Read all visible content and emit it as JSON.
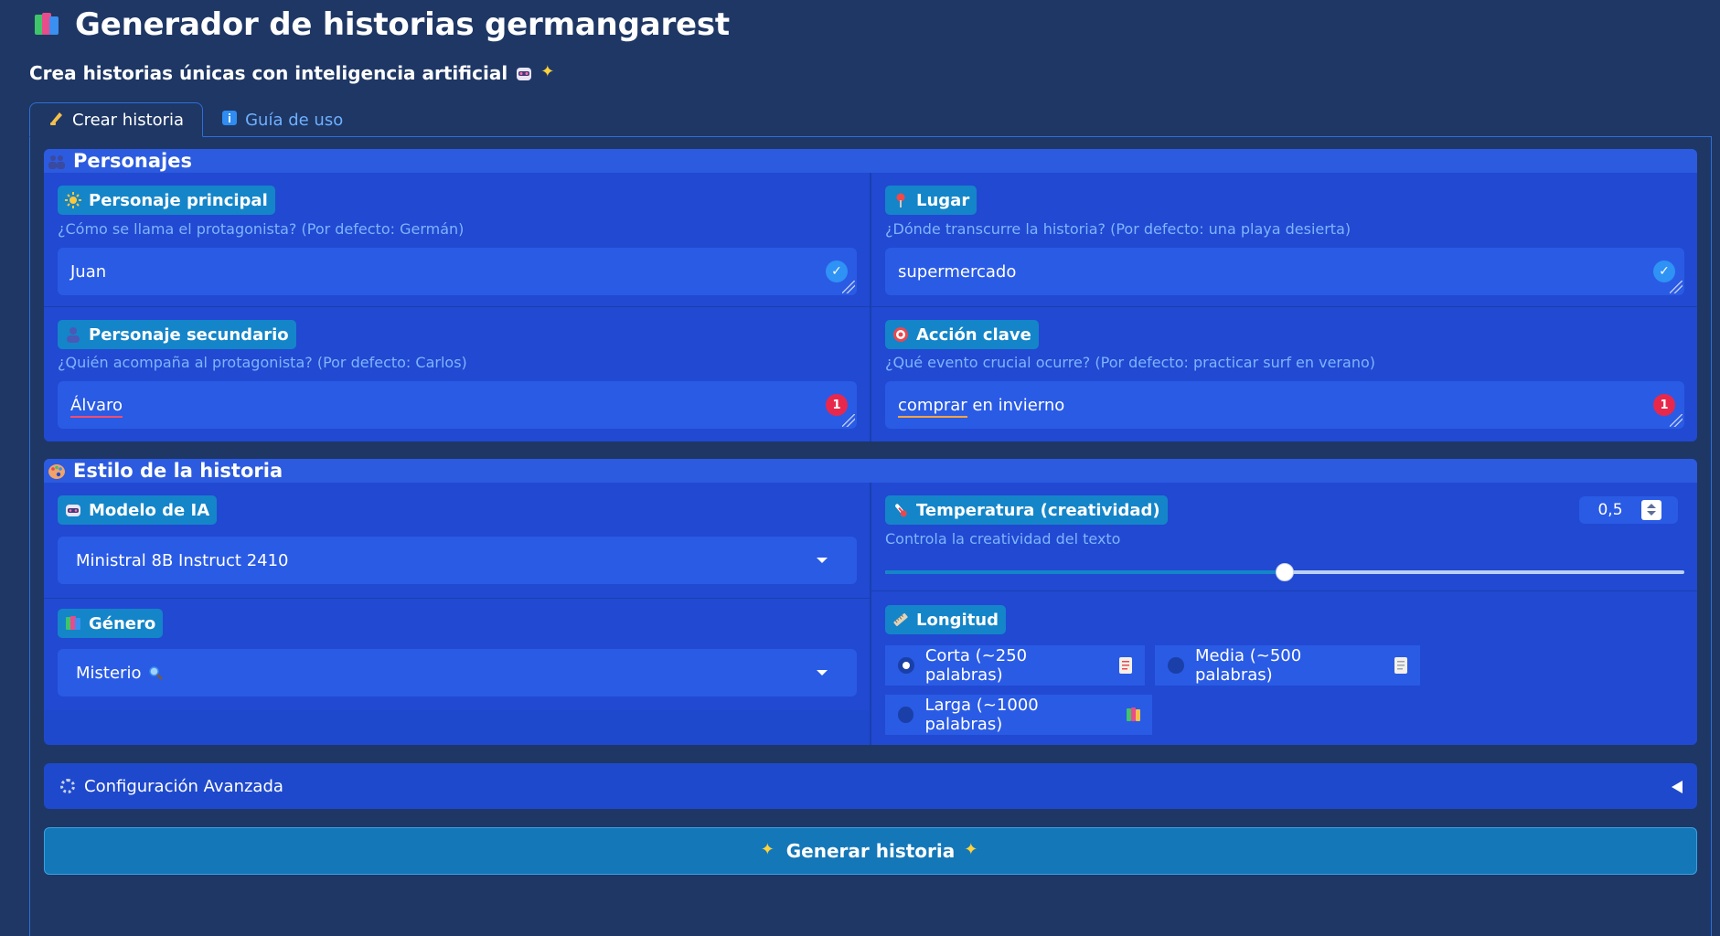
{
  "header": {
    "title": "Generador de historias germangarest",
    "subtitle": "Crea historias únicas con inteligencia artificial"
  },
  "tabs": [
    {
      "label": "Crear historia",
      "active": true
    },
    {
      "label": "Guía de uso",
      "active": false
    }
  ],
  "personajes": {
    "title": "Personajes",
    "principal": {
      "label": "Personaje principal",
      "hint": "¿Cómo se llama el protagonista? (Por defecto: Germán)",
      "value": "Juan",
      "status": "ok"
    },
    "lugar": {
      "label": "Lugar",
      "hint": "¿Dónde transcurre la historia? (Por defecto: una playa desierta)",
      "value": "supermercado",
      "status": "ok"
    },
    "secundario": {
      "label": "Personaje secundario",
      "hint": "¿Quién acompaña al protagonista? (Por defecto: Carlos)",
      "value": "Álvaro",
      "errors": "1"
    },
    "accion": {
      "label": "Acción clave",
      "hint": "¿Qué evento crucial ocurre? (Por defecto: practicar surf en verano)",
      "value_word1": "comprar",
      "value_rest": " en invierno",
      "errors": "1"
    }
  },
  "estilo": {
    "title": "Estilo de la historia",
    "modelo": {
      "label": "Modelo de IA",
      "selected": "Ministral 8B Instruct 2410"
    },
    "genero": {
      "label": "Género",
      "selected": "Misterio"
    },
    "temperatura": {
      "label": "Temperatura (creatividad)",
      "hint": "Controla la creatividad del texto",
      "value": "0,5",
      "fraction": 0.5
    },
    "longitud": {
      "label": "Longitud",
      "options": [
        {
          "label": "Corta (~250 palabras)",
          "checked": true
        },
        {
          "label": "Media (~500 palabras)",
          "checked": false
        },
        {
          "label": "Larga (~1000 palabras)",
          "checked": false
        }
      ]
    }
  },
  "advanced": {
    "label": "Configuración Avanzada"
  },
  "generate": {
    "label": "Generar historia"
  },
  "icons": {
    "title": "books-icon",
    "subtitle": [
      "robot-icon",
      "sparkles-icon"
    ],
    "tab_crear": "writing-hand-icon",
    "tab_guia": "info-icon",
    "personajes": "people-icon",
    "principal": "sun-icon",
    "lugar": "pin-icon",
    "secundario": "person-icon",
    "accion": "target-icon",
    "estilo": "palette-icon",
    "modelo": "robot-icon",
    "genero": "books-icon",
    "misterio": "magnifier-icon",
    "temperatura": "thermometer-icon",
    "longitud": "ruler-icon",
    "advanced": "gear-icon",
    "generate": "sparkles-icon"
  },
  "colors": {
    "background": "#1e3765",
    "section": "#1f49cc",
    "input": "#2a5be5",
    "chip": "#1485c9",
    "hint": "#7fb4ff",
    "ok_badge": "#2f92f5",
    "error_badge": "#e7284c",
    "button": "#1477b8"
  }
}
